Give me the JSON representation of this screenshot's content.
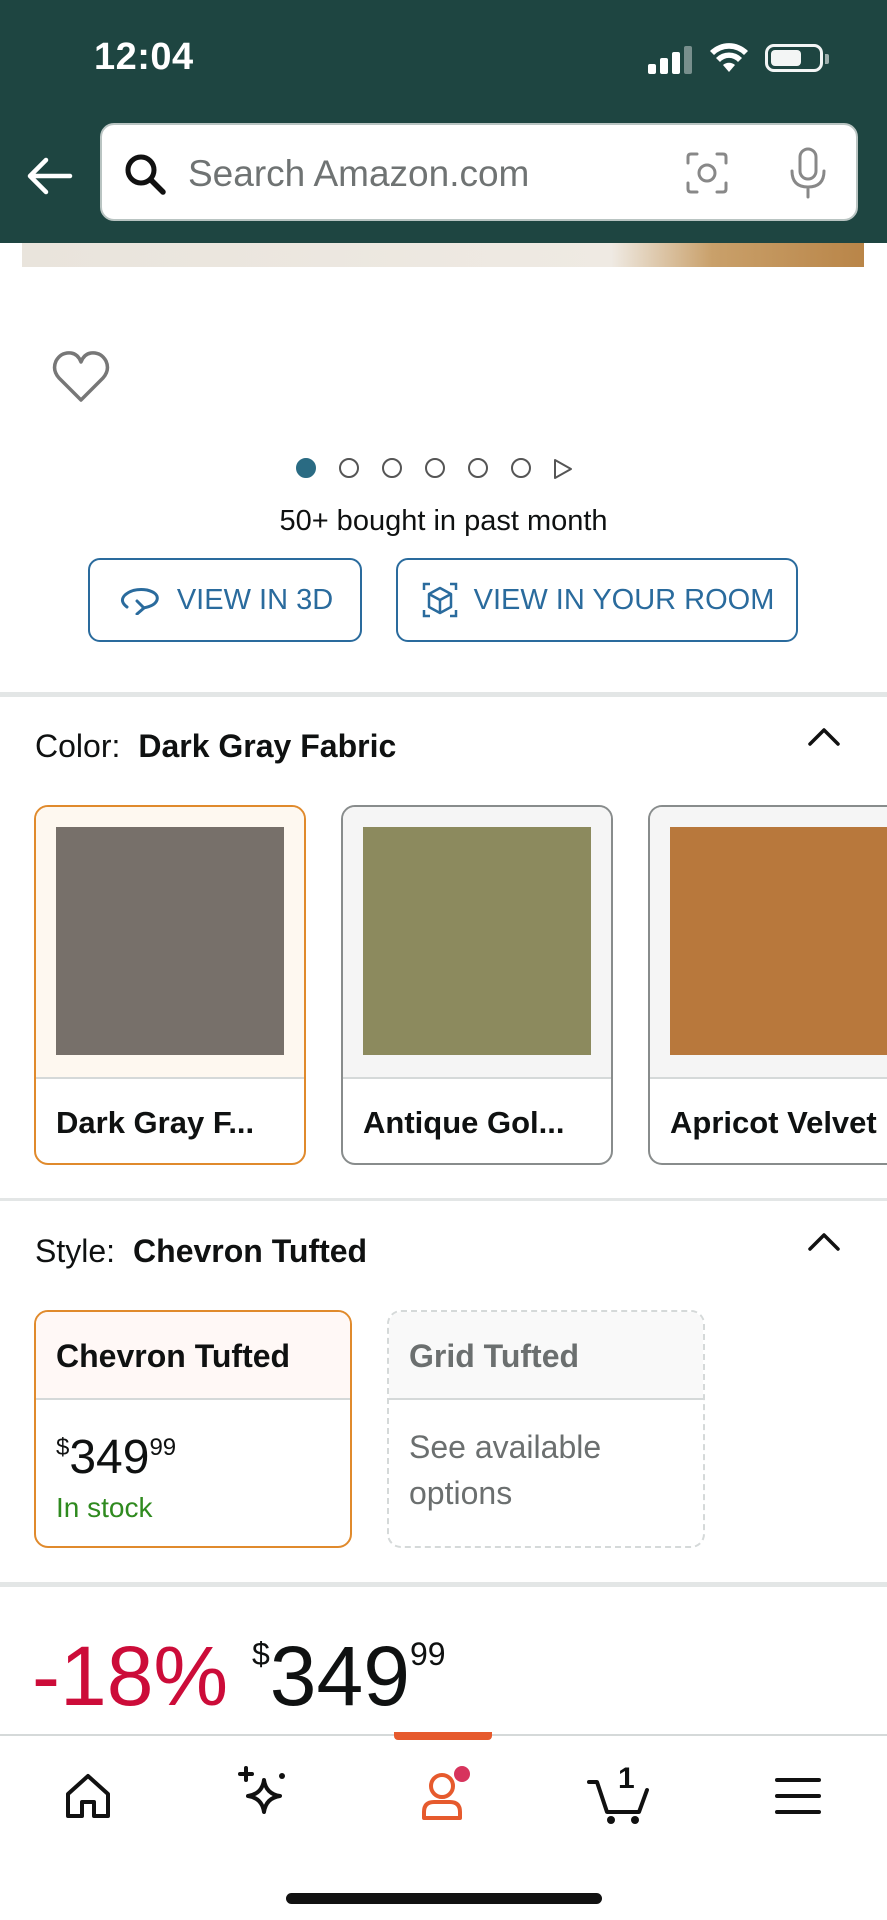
{
  "status_bar": {
    "time": "12:04"
  },
  "search": {
    "placeholder": "Search Amazon.com"
  },
  "product": {
    "bought_text": "50+ bought in past month",
    "image_dots": {
      "count": 6,
      "active_index": 0
    }
  },
  "buttons": {
    "view_3d": "VIEW IN 3D",
    "view_room": "VIEW IN YOUR ROOM"
  },
  "color": {
    "label": "Color:",
    "selected": "Dark Gray Fabric",
    "options": [
      {
        "label": "Dark Gray F...",
        "swatch_color": "#77706a",
        "selected": true
      },
      {
        "label": "Antique Gol...",
        "swatch_color": "#8c8a5e",
        "selected": false
      },
      {
        "label": "Apricot Velvet",
        "swatch_color": "#b8783c",
        "selected": false
      }
    ]
  },
  "style": {
    "label": "Style:",
    "selected": "Chevron Tufted",
    "options": [
      {
        "name": "Chevron Tufted",
        "currency": "$",
        "price_whole": "349",
        "price_fraction": "99",
        "availability": "In stock"
      },
      {
        "name": "Grid Tufted",
        "note": "See available options"
      }
    ]
  },
  "price": {
    "discount": "-18%",
    "currency": "$",
    "whole": "349",
    "fraction": "99"
  },
  "bottom_nav": {
    "items": [
      "home-icon",
      "sparkle-icon",
      "account-icon",
      "cart-icon",
      "menu-icon"
    ],
    "active_index": 2,
    "cart_count": "1"
  },
  "colors": {
    "header_bg": "#1e4541",
    "accent_link": "#2a6b9d",
    "selected_border": "#e08a2c",
    "discount_red": "#cc0c39",
    "in_stock_green": "#2f8a1f"
  }
}
